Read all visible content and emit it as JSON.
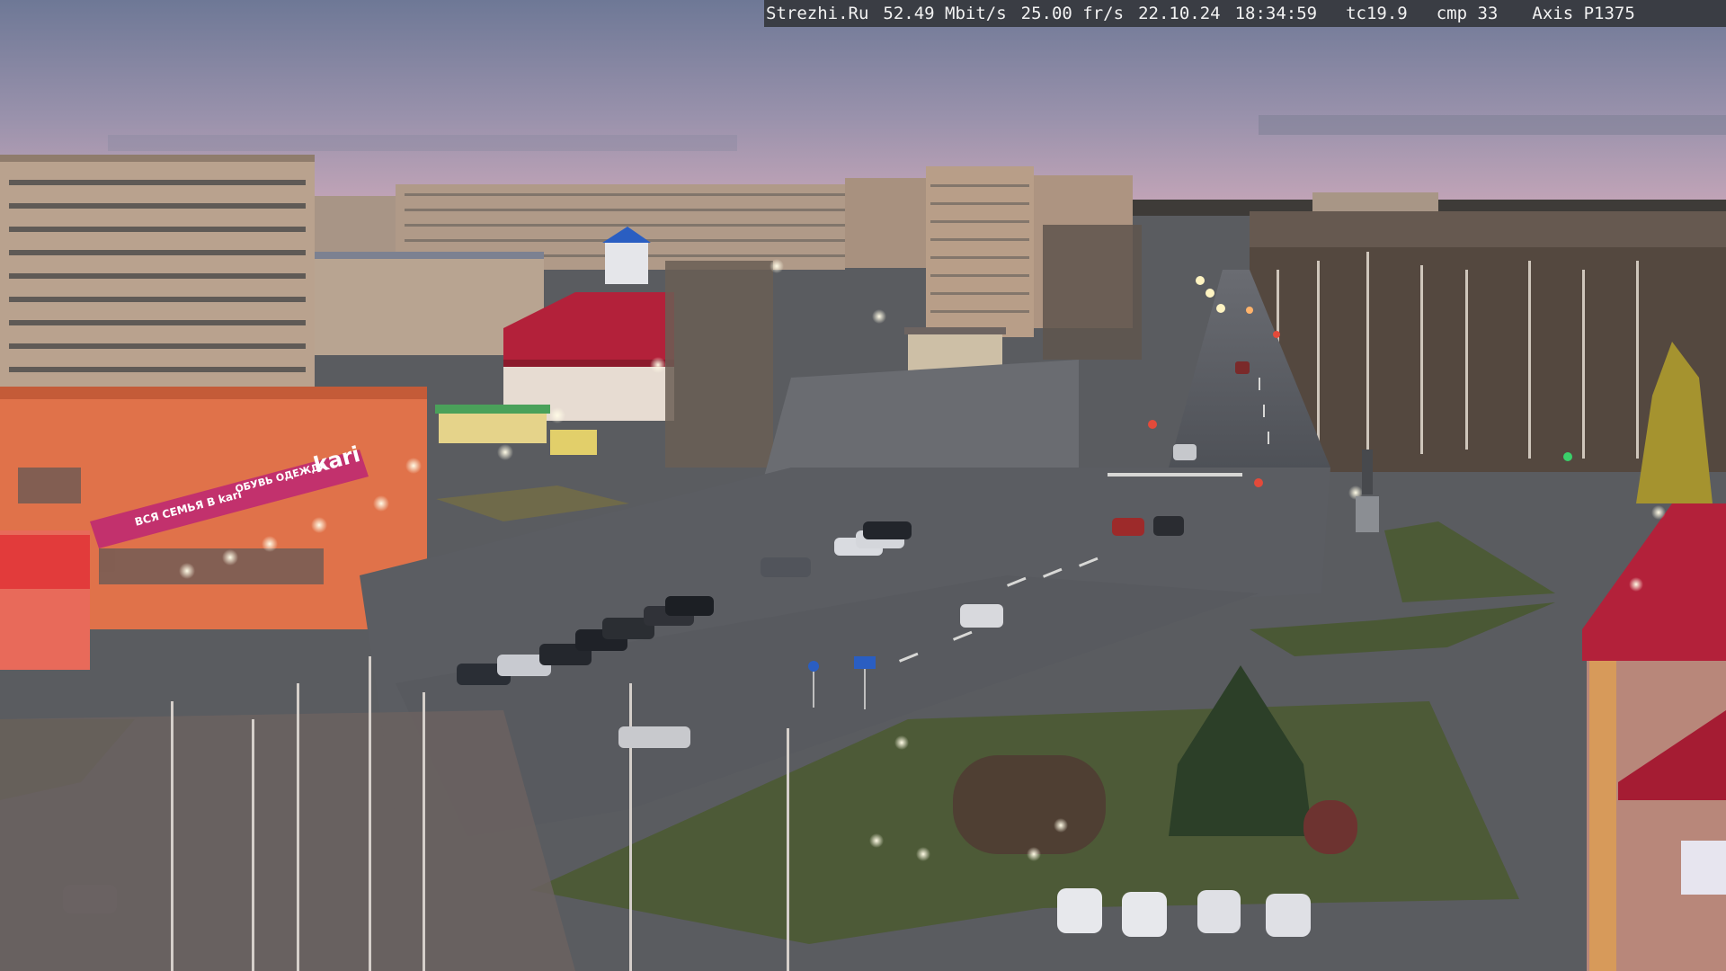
{
  "overlay": {
    "site": "Strezhi.Ru",
    "bitrate": "52.49 Mbit/s",
    "framerate": "25.00 fr/s",
    "date": "22.10.24",
    "time": "18:34:59",
    "tc": "tc19.9",
    "cmp": "cmp 33",
    "camera": "Axis P1375"
  },
  "signage": {
    "store_brand": "kari",
    "store_slogan_1": "ВСЯ СЕМЬЯ В kari",
    "store_slogan_2": "ОБУВЬ ОДЕЖДА"
  },
  "colors": {
    "sky_top": "#6f7a97",
    "sky_mid": "#9a8fa6",
    "sky_horizon": "#c7a4b5",
    "building_beige": "#b7a08c",
    "store_facade": "#e0724a",
    "store_banner": "#c2316d",
    "road": "#56595e",
    "grass": "#4d5a37",
    "roof_red": "#b3213a",
    "lamp_glow": "#fff6d6",
    "osd_bg": "#3a3d44"
  }
}
